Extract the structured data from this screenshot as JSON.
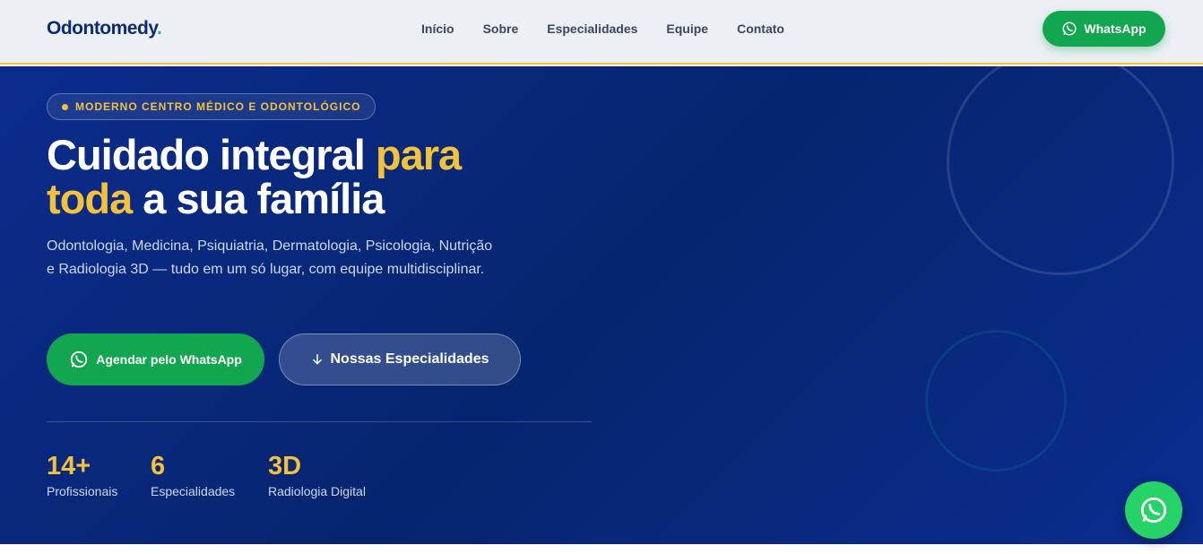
{
  "header": {
    "logo_text": "Odontomedy",
    "logo_dot": ".",
    "nav": [
      "Início",
      "Sobre",
      "Especialidades",
      "Equipe",
      "Contato"
    ],
    "whatsapp_label": "WhatsApp"
  },
  "hero": {
    "badge": "MODERNO CENTRO MÉDICO E ODONTOLÓGICO",
    "title_part1": "Cuidado integral ",
    "title_hl1": "para",
    "title_hl2": "toda",
    "title_part2": " a sua família",
    "description": "Odontologia, Medicina, Psiquiatria, Dermatologia, Psicologia, Nutrição e Radiologia 3D — tudo em um só lugar, com equipe multidisciplinar.",
    "cta_whatsapp": "Agendar pelo WhatsApp",
    "cta_specialties": "Nossas Especialidades",
    "stats": [
      {
        "value": "14+",
        "label": "Profissionais"
      },
      {
        "value": "6",
        "label": "Especialidades"
      },
      {
        "value": "3D",
        "label": "Radiologia Digital"
      }
    ]
  },
  "icons": {
    "whatsapp": "whatsapp-icon",
    "arrow_down": "arrow-down-icon"
  },
  "colors": {
    "primary": "#0b2c8c",
    "accent": "#f4c13a",
    "whatsapp": "#13a651"
  }
}
